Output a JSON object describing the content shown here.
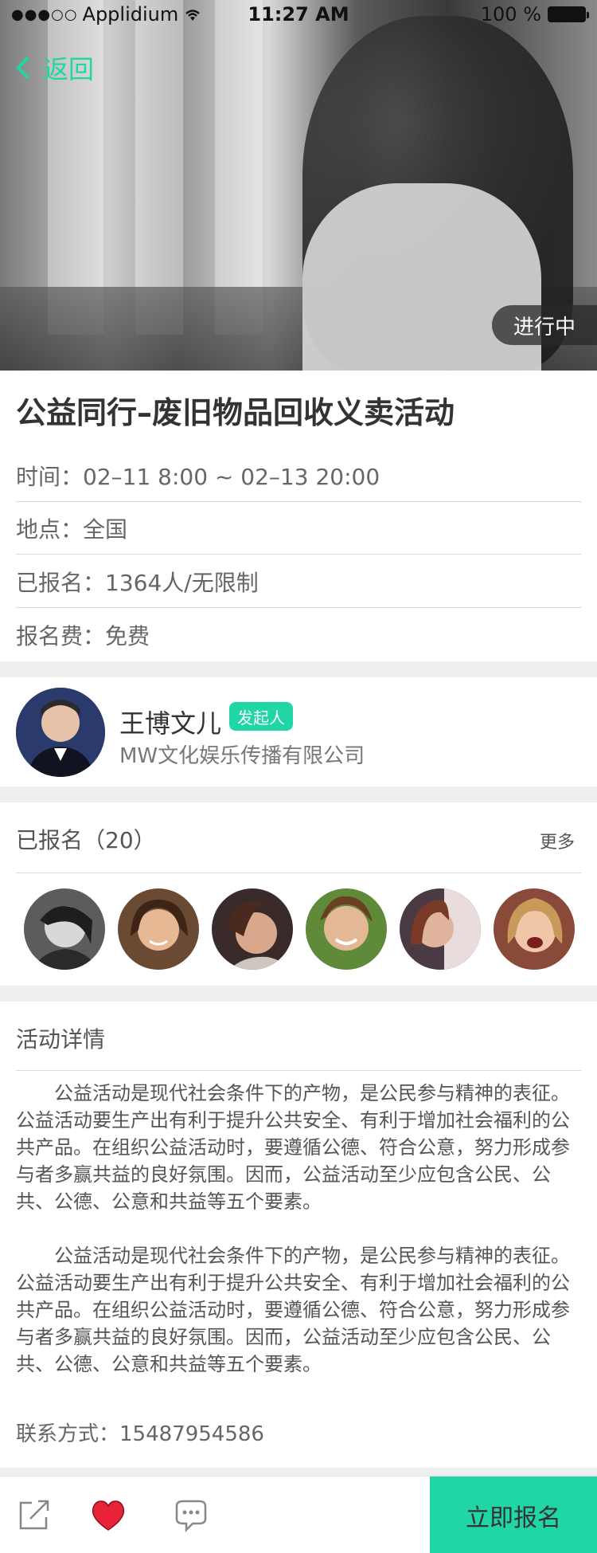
{
  "statusbar": {
    "signal_dots": "●●●○○",
    "carrier": "Applidium",
    "time": "11:27 AM",
    "battery": "100 %"
  },
  "nav": {
    "back_label": "返回"
  },
  "hero": {
    "status_pill": "进行中"
  },
  "event": {
    "title": "公益同行–废旧物品回收义卖活动",
    "time": "时间：02–11 8:00 ~ 02–13 20:00",
    "location": "地点：全国",
    "registered": "已报名：1364人/无限制",
    "fee": "报名费：免费"
  },
  "organizer": {
    "name": "王博文儿",
    "badge": "发起人",
    "company": "MW文化娱乐传播有限公司"
  },
  "registered_section": {
    "title": "已报名（20）",
    "more": "更多",
    "avatars": [
      "avatar-1",
      "avatar-2",
      "avatar-3",
      "avatar-4",
      "avatar-5",
      "avatar-6"
    ]
  },
  "details": {
    "title": "活动详情",
    "para1": "公益活动是现代社会条件下的产物，是公民参与精神的表征。公益活动要生产出有利于提升公共安全、有利于增加社会福利的公共产品。在组织公益活动时，要遵循公德、符合公意，努力形成参与者多赢共益的良好氛围。因而，公益活动至少应包含公民、公共、公德、公意和共益等五个要素。",
    "para2": "公益活动是现代社会条件下的产物，是公民参与精神的表征。公益活动要生产出有利于提升公共安全、有利于增加社会福利的公共产品。在组织公益活动时，要遵循公德、符合公意，努力形成参与者多赢共益的良好氛围。因而，公益活动至少应包含公民、公共、公德、公意和共益等五个要素。",
    "contact": "联系方式：15487954586"
  },
  "bottombar": {
    "share_icon": "share-icon",
    "like_icon": "heart-icon",
    "comment_icon": "chat-icon",
    "cta_label": "立即报名"
  },
  "colors": {
    "accent": "#1fd6a4",
    "heart": "#e8233a"
  }
}
